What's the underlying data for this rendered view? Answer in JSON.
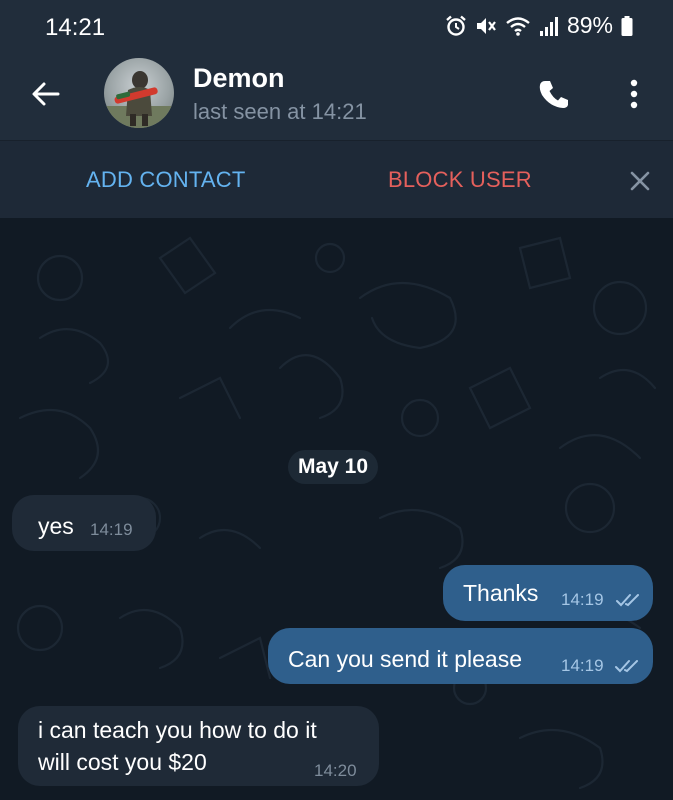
{
  "status_bar": {
    "time": "14:21",
    "battery": "89%",
    "icons": [
      "alarm-icon",
      "mute-icon",
      "wifi-icon",
      "signal-icon",
      "battery-icon"
    ]
  },
  "header": {
    "contact_name": "Demon",
    "last_seen": "last seen at 14:21",
    "icons": [
      "back-arrow-icon",
      "phone-icon",
      "more-vertical-icon"
    ]
  },
  "action_bar": {
    "add_contact": "ADD CONTACT",
    "block_user": "BLOCK USER",
    "close_icon": "close-icon"
  },
  "chat": {
    "date_separator": "May 10",
    "messages": [
      {
        "direction": "incoming",
        "lines": [
          "yes"
        ],
        "time": "14:19"
      },
      {
        "direction": "outgoing",
        "lines": [
          "Thanks"
        ],
        "time": "14:19",
        "status": "read"
      },
      {
        "direction": "outgoing",
        "lines": [
          "Can you send it please"
        ],
        "time": "14:19",
        "status": "read"
      },
      {
        "direction": "incoming",
        "lines": [
          "i can teach you how to do it",
          "will cost you $20"
        ],
        "time": "14:20"
      }
    ]
  },
  "colors": {
    "header_bg": "#212d3b",
    "chat_bg": "#111a24",
    "incoming_bubble": "#1f2a37",
    "outgoing_bubble": "#2f5f8c",
    "add_contact": "#64b3f0",
    "block_user": "#e5605c"
  }
}
